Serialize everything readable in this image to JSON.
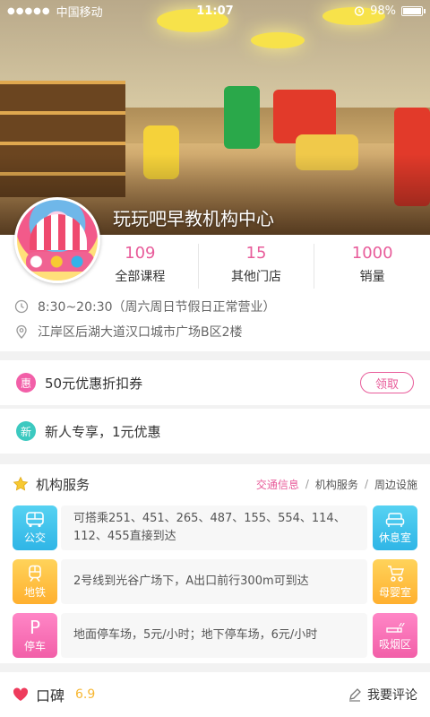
{
  "status_bar": {
    "signal": "●●●●●",
    "carrier": "中国移动",
    "time": "11:07",
    "battery": "98%",
    "battery_level": 0.98
  },
  "store": {
    "name": "玩玩吧早教机构中心",
    "stats": [
      {
        "value": "109",
        "label": "全部课程"
      },
      {
        "value": "15",
        "label": "其他门店"
      },
      {
        "value": "1000",
        "label": "销量"
      }
    ],
    "hours": "8:30~20:30（周六周日节假日正常营业）",
    "address": "江岸区后湖大道汉口城市广场B区2楼"
  },
  "coupons": [
    {
      "badge": "惠",
      "text": "50元优惠折扣券",
      "action": "领取",
      "color": "#f25fa8"
    },
    {
      "badge": "新",
      "text": "新人专享，1元优惠",
      "color": "#3cc9c0"
    }
  ],
  "services": {
    "title": "机构服务",
    "tabs": [
      "交通信息",
      "机构服务",
      "周边设施"
    ],
    "active_tab": 0,
    "rows": [
      {
        "left_label": "公交",
        "left_icon": "bus-icon",
        "text": "可搭乘251、451、265、487、155、554、114、112、455直接到达",
        "right_label": "休息室",
        "right_icon": "sofa-icon",
        "color": "blue"
      },
      {
        "left_label": "地铁",
        "left_icon": "subway-icon",
        "text": "2号线到光谷广场下，A出口前行300m可到达",
        "right_label": "母婴室",
        "right_icon": "stroller-icon",
        "color": "orange"
      },
      {
        "left_label": "停车",
        "left_icon": "parking-icon",
        "left_glyph": "P",
        "text": "地面停车场，5元/小时；地下停车场，6元/小时",
        "right_label": "吸烟区",
        "right_icon": "cigarette-icon",
        "color": "pink"
      }
    ]
  },
  "reviews": {
    "title": "口碑",
    "score": "6.9",
    "write": "我要评论"
  }
}
